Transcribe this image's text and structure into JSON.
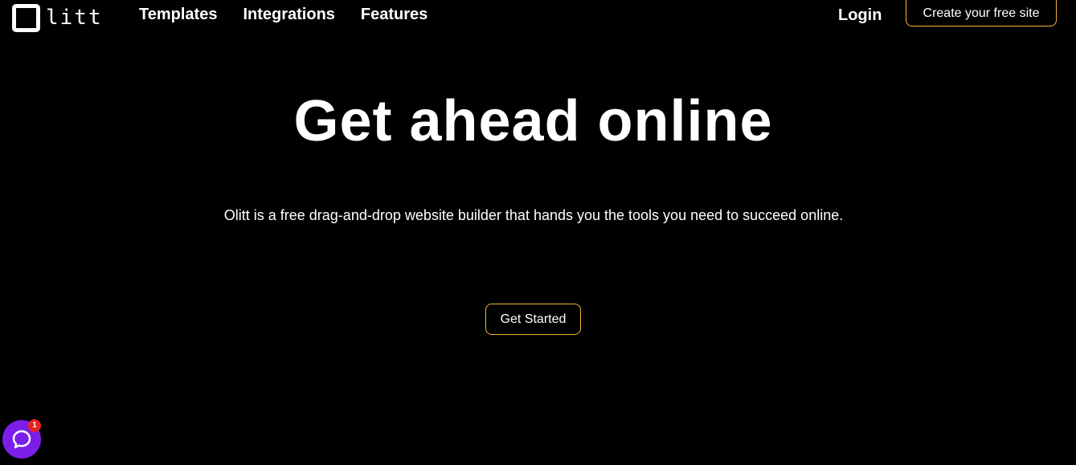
{
  "header": {
    "logo_text": "litt",
    "nav": [
      "Templates",
      "Integrations",
      "Features"
    ],
    "login_label": "Login",
    "cta_label": "Create your free site"
  },
  "hero": {
    "title": "Get ahead online",
    "subtitle": "Olitt is a free drag-and-drop website builder that hands you the tools you need to succeed online.",
    "button_label": "Get Started"
  },
  "chat_widget": {
    "icon": "chat-bubble-icon",
    "badge_count": "1"
  },
  "colors": {
    "background": "#000000",
    "text": "#ffffff",
    "accent_border": "#f2b233",
    "chat_bg": "#7b1fe8",
    "badge_bg": "#e8231f"
  }
}
